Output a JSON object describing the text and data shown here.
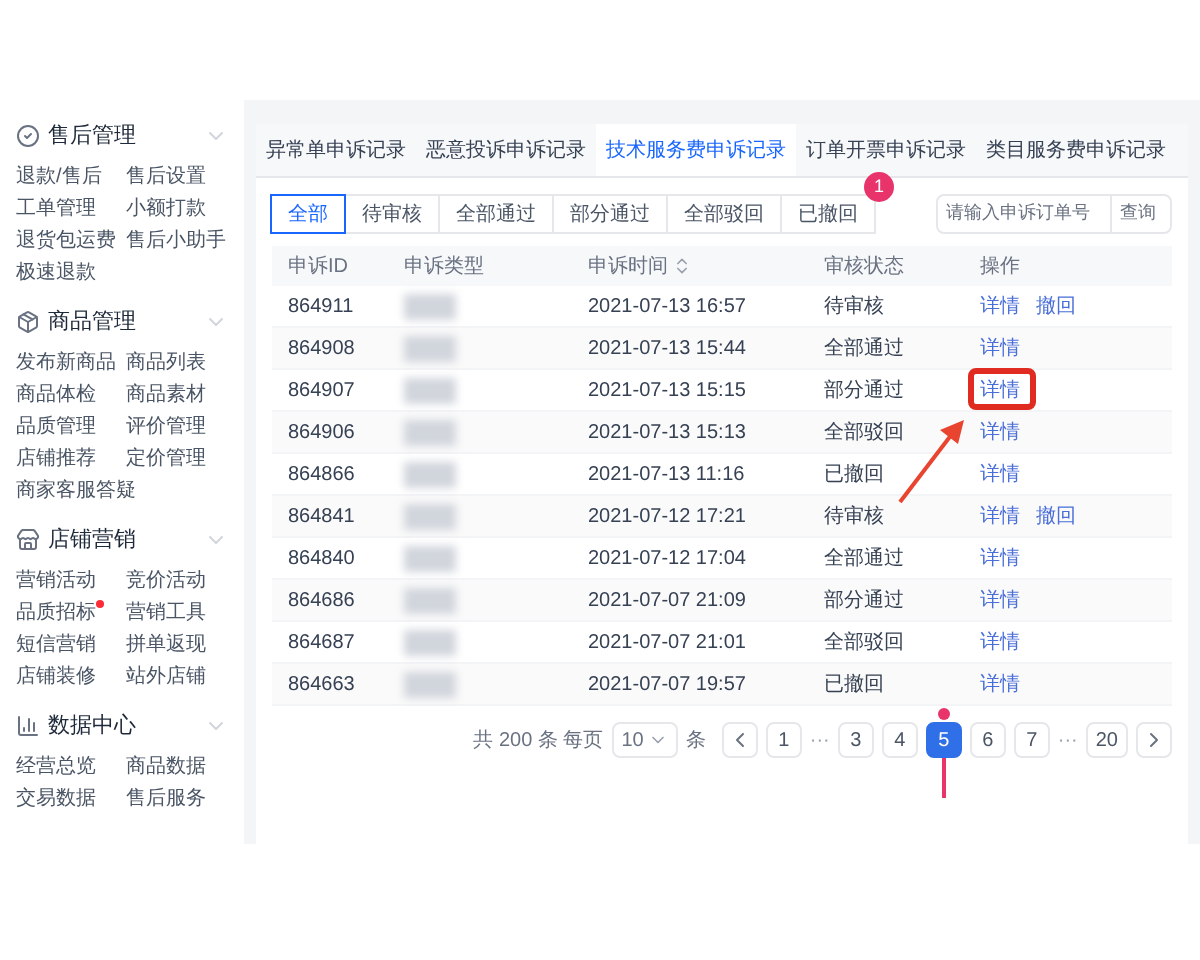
{
  "sidebar": {
    "sections": [
      {
        "kind": "aftersale",
        "title": "售后管理",
        "items": [
          {
            "label": "退款/售后",
            "dot": false
          },
          {
            "label": "售后设置",
            "dot": false
          },
          {
            "label": "工单管理",
            "dot": false
          },
          {
            "label": "小额打款",
            "dot": false
          },
          {
            "label": "退货包运费",
            "dot": false
          },
          {
            "label": "售后小助手",
            "dot": false
          },
          {
            "label": "极速退款",
            "dot": false
          }
        ]
      },
      {
        "kind": "goods",
        "title": "商品管理",
        "items": [
          {
            "label": "发布新商品",
            "dot": false
          },
          {
            "label": "商品列表",
            "dot": false
          },
          {
            "label": "商品体检",
            "dot": false
          },
          {
            "label": "商品素材",
            "dot": false
          },
          {
            "label": "品质管理",
            "dot": false
          },
          {
            "label": "评价管理",
            "dot": false
          },
          {
            "label": "店铺推荐",
            "dot": false
          },
          {
            "label": "定价管理",
            "dot": false
          },
          {
            "label": "商家客服答疑",
            "dot": false
          }
        ]
      },
      {
        "kind": "marketing",
        "title": "店铺营销",
        "items": [
          {
            "label": "营销活动",
            "dot": false
          },
          {
            "label": "竞价活动",
            "dot": false
          },
          {
            "label": "品质招标",
            "dot": true
          },
          {
            "label": "营销工具",
            "dot": false
          },
          {
            "label": "短信营销",
            "dot": false
          },
          {
            "label": "拼单返现",
            "dot": false
          },
          {
            "label": "店铺装修",
            "dot": false
          },
          {
            "label": "站外店铺",
            "dot": false
          }
        ]
      },
      {
        "kind": "data",
        "title": "数据中心",
        "items": [
          {
            "label": "经营总览",
            "dot": false
          },
          {
            "label": "商品数据",
            "dot": false
          },
          {
            "label": "交易数据",
            "dot": false
          },
          {
            "label": "售后服务",
            "dot": false
          }
        ]
      }
    ]
  },
  "tabs": [
    {
      "label": "异常单申诉记录",
      "selected": false
    },
    {
      "label": "恶意投诉申诉记录",
      "selected": false
    },
    {
      "label": "技术服务费申诉记录",
      "selected": true
    },
    {
      "label": "订单开票申诉记录",
      "selected": false
    },
    {
      "label": "类目服务费申诉记录",
      "selected": false
    }
  ],
  "filters": [
    {
      "label": "全部",
      "selected": true
    },
    {
      "label": "待审核",
      "selected": false
    },
    {
      "label": "全部通过",
      "selected": false
    },
    {
      "label": "部分通过",
      "selected": false
    },
    {
      "label": "全部驳回",
      "selected": false
    },
    {
      "label": "已撤回",
      "selected": false,
      "badge": "1"
    }
  ],
  "search": {
    "placeholder": "请输入申诉订单号",
    "button": "查询"
  },
  "table": {
    "columns": [
      "申诉ID",
      "申诉类型",
      "申诉时间",
      "审核状态",
      "操作"
    ],
    "rows": [
      {
        "id": "864911",
        "time": "2021-07-13 16:57",
        "status": "待审核",
        "actions": [
          "详情",
          "撤回"
        ],
        "highlighted": false
      },
      {
        "id": "864908",
        "time": "2021-07-13 15:44",
        "status": "全部通过",
        "actions": [
          "详情"
        ],
        "highlighted": false
      },
      {
        "id": "864907",
        "time": "2021-07-13 15:15",
        "status": "部分通过",
        "actions": [
          "详情"
        ],
        "highlighted": true
      },
      {
        "id": "864906",
        "time": "2021-07-13 15:13",
        "status": "全部驳回",
        "actions": [
          "详情"
        ],
        "highlighted": false
      },
      {
        "id": "864866",
        "time": "2021-07-13 11:16",
        "status": "已撤回",
        "actions": [
          "详情"
        ],
        "highlighted": false
      },
      {
        "id": "864841",
        "time": "2021-07-12 17:21",
        "status": "待审核",
        "actions": [
          "详情",
          "撤回"
        ],
        "highlighted": false
      },
      {
        "id": "864840",
        "time": "2021-07-12 17:04",
        "status": "全部通过",
        "actions": [
          "详情"
        ],
        "highlighted": false
      },
      {
        "id": "864686",
        "time": "2021-07-07 21:09",
        "status": "部分通过",
        "actions": [
          "详情"
        ],
        "highlighted": false
      },
      {
        "id": "864687",
        "time": "2021-07-07 21:01",
        "status": "全部驳回",
        "actions": [
          "详情"
        ],
        "highlighted": false
      },
      {
        "id": "864663",
        "time": "2021-07-07 19:57",
        "status": "已撤回",
        "actions": [
          "详情"
        ],
        "highlighted": false
      }
    ]
  },
  "pagination": {
    "total": "共 200 条 每页",
    "page_size": "10",
    "unit": "条",
    "pages": [
      {
        "kind": "page",
        "label": "1",
        "selected": false,
        "pinned": false
      },
      {
        "kind": "ellipsis",
        "label": "···"
      },
      {
        "kind": "page",
        "label": "3",
        "selected": false,
        "pinned": false
      },
      {
        "kind": "page",
        "label": "4",
        "selected": false,
        "pinned": false
      },
      {
        "kind": "page",
        "label": "5",
        "selected": true,
        "pinned": true
      },
      {
        "kind": "page",
        "label": "6",
        "selected": false,
        "pinned": false
      },
      {
        "kind": "page",
        "label": "7",
        "selected": false,
        "pinned": false
      },
      {
        "kind": "ellipsis",
        "label": "···"
      },
      {
        "kind": "page",
        "label": "20",
        "selected": false,
        "pinned": false
      }
    ]
  }
}
